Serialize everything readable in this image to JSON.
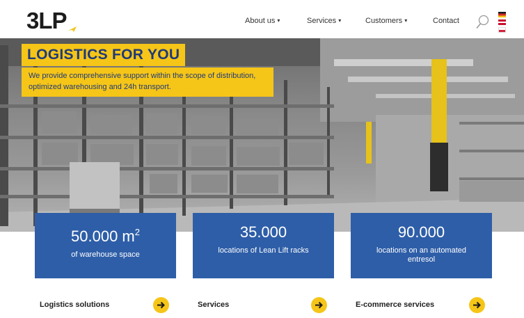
{
  "header": {
    "logo": "3LP",
    "nav": [
      {
        "label": "About us",
        "has_dropdown": true
      },
      {
        "label": "Services",
        "has_dropdown": true
      },
      {
        "label": "Customers",
        "has_dropdown": true
      },
      {
        "label": "Contact",
        "has_dropdown": false
      }
    ],
    "search_icon": "search-icon",
    "languages": [
      "de",
      "en",
      "pl"
    ]
  },
  "hero": {
    "headline": "LOGISTICS FOR YOU",
    "subheadline": "We provide comprehensive support within the scope of distribution, optimized warehousing and 24h transport."
  },
  "stats": [
    {
      "value": "50.000 m",
      "sup": "2",
      "label": "of warehouse space"
    },
    {
      "value": "35.000",
      "sup": "",
      "label": "locations of Lean Lift racks"
    },
    {
      "value": "90.000",
      "sup": "",
      "label": "locations on an automated entresol"
    }
  ],
  "cards": [
    {
      "title": "Logistics solutions",
      "arrow_icon": "arrow-right-icon"
    },
    {
      "title": "Services",
      "arrow_icon": "arrow-right-icon"
    },
    {
      "title": "E-commerce services",
      "arrow_icon": "arrow-right-icon"
    }
  ],
  "colors": {
    "accent_yellow": "#f5c518",
    "stat_blue": "#2e5ea8",
    "headline_text": "#1f3a7a"
  }
}
